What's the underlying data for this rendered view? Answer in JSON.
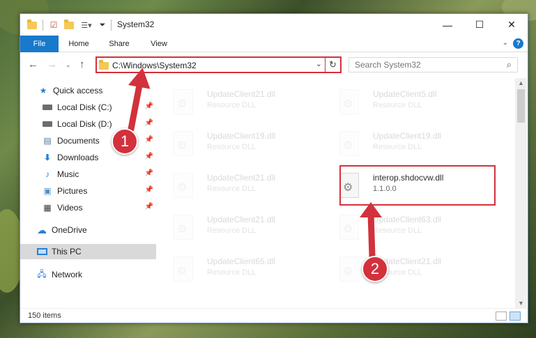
{
  "window": {
    "title": "System32",
    "controls": {
      "minimize": "—",
      "maximize": "☐",
      "close": "✕"
    }
  },
  "ribbon": {
    "tabs": [
      "File",
      "Home",
      "Share",
      "View"
    ],
    "help": "?"
  },
  "address": {
    "path": "C:\\Windows\\System32",
    "search_placeholder": "Search System32"
  },
  "nav": {
    "quick_access": "Quick access",
    "items": [
      {
        "label": "Local Disk (C:)",
        "icon": "drive-icon",
        "pinned": true
      },
      {
        "label": "Local Disk (D:)",
        "icon": "drive-icon",
        "pinned": true
      },
      {
        "label": "Documents",
        "icon": "documents-icon",
        "pinned": true
      },
      {
        "label": "Downloads",
        "icon": "download-icon",
        "pinned": true
      },
      {
        "label": "Music",
        "icon": "music-icon",
        "pinned": true
      },
      {
        "label": "Pictures",
        "icon": "pictures-icon",
        "pinned": true
      },
      {
        "label": "Videos",
        "icon": "videos-icon",
        "pinned": true
      }
    ],
    "onedrive": "OneDrive",
    "this_pc": "This PC",
    "network": "Network"
  },
  "files": [
    {
      "name": "UpdateClient21.dll",
      "sub": "Resource DLL",
      "faded": true
    },
    {
      "name": "UpdateClient5.dll",
      "sub": "Resource DLL",
      "faded": true
    },
    {
      "name": "UpdateClient19.dll",
      "sub": "Resource DLL",
      "faded": true
    },
    {
      "name": "UpdateClient19.dll",
      "sub": "Resource DLL",
      "faded": true
    },
    {
      "name": "UpdateClient21.dll",
      "sub": "Resource DLL",
      "faded": true
    },
    {
      "name": "interop.shdocvw.dll",
      "sub": "1.1.0.0",
      "faded": false
    },
    {
      "name": "UpdateClient21.dll",
      "sub": "Resource DLL",
      "faded": true
    },
    {
      "name": "UpdateClient63.dll",
      "sub": "Resource DLL",
      "faded": true
    },
    {
      "name": "UpdateClient65.dll",
      "sub": "Resource DLL",
      "faded": true
    },
    {
      "name": "UpdateClient21.dll",
      "sub": "Resource DLL",
      "faded": true
    }
  ],
  "status": {
    "count": "150 items"
  },
  "callouts": {
    "step1": "1",
    "step2": "2",
    "color": "#d3313c"
  },
  "colors": {
    "accent": "#1979ca",
    "highlight": "#d3313c",
    "selected_nav": "#d9d9d9"
  }
}
